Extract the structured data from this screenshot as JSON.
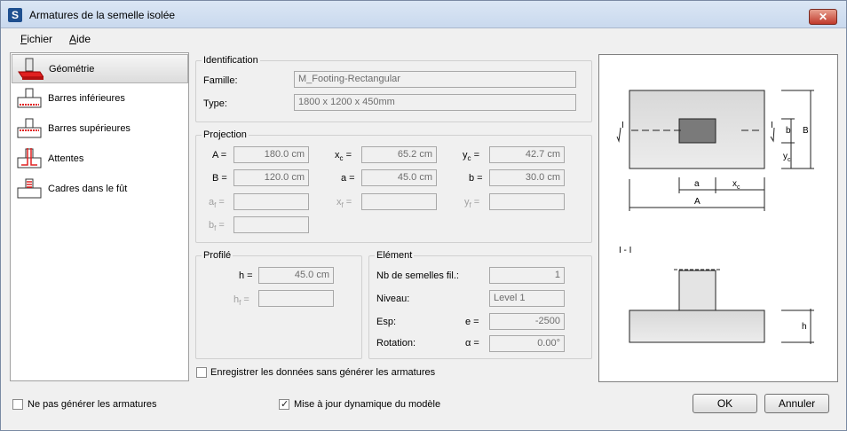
{
  "window": {
    "title": "Armatures de la semelle isolée",
    "app_icon": "S",
    "close_glyph": "✕"
  },
  "menu": {
    "items": [
      {
        "accel": "F",
        "rest": "ichier"
      },
      {
        "accel": "A",
        "rest": "ide"
      }
    ]
  },
  "nav": {
    "items": [
      {
        "label": "Géométrie",
        "icon": "footing-geometry-icon"
      },
      {
        "label": "Barres inférieures",
        "icon": "bottom-bars-icon"
      },
      {
        "label": "Barres supérieures",
        "icon": "top-bars-icon"
      },
      {
        "label": "Attentes",
        "icon": "starter-bars-icon"
      },
      {
        "label": "Cadres dans le fût",
        "icon": "pier-stirrups-icon"
      }
    ]
  },
  "identification": {
    "legend": "Identification",
    "famille_label": "Famille:",
    "famille_value": "M_Footing-Rectangular",
    "type_label": "Type:",
    "type_value": "1800 x 1200 x 450mm"
  },
  "projection": {
    "legend": "Projection",
    "A_label": "A =",
    "A_value": "180.0 cm",
    "B_label": "B =",
    "B_value": "120.0 cm",
    "af_base": "a",
    "af_sub": "f",
    "af_eq": "=",
    "af_value": "",
    "bf_base": "b",
    "bf_sub": "f",
    "bf_eq": "=",
    "bf_value": "",
    "xc_base": "x",
    "xc_sub": "c",
    "xc_eq": "=",
    "xc_value": "65.2 cm",
    "a_label": "a =",
    "a_value": "45.0 cm",
    "xf_base": "x",
    "xf_sub": "f",
    "xf_eq": "=",
    "xf_value": "",
    "yc_base": "y",
    "yc_sub": "c",
    "yc_eq": "=",
    "yc_value": "42.7 cm",
    "b_label": "b =",
    "b_value": "30.0 cm",
    "yf_base": "y",
    "yf_sub": "f",
    "yf_eq": "=",
    "yf_value": ""
  },
  "profile": {
    "legend": "Profilé",
    "h_label": "h =",
    "h_value": "45.0 cm",
    "hf_base": "h",
    "hf_sub": "f",
    "hf_eq": "=",
    "hf_value": ""
  },
  "element": {
    "legend": "Elément",
    "nb_label": "Nb de semelles fil.:",
    "nb_value": "1",
    "niveau_label": "Niveau:",
    "niveau_value": "Level 1",
    "esp_label": "Esp:",
    "e_label": "e =",
    "e_value": "-2500",
    "rotation_label": "Rotation:",
    "alpha_label": "α =",
    "alpha_value": "0.00°"
  },
  "options": {
    "save_data_label": "Enregistrer les données sans générer les armatures",
    "save_data_checked": false,
    "no_generate_label": "Ne pas générer les armatures",
    "no_generate_checked": false,
    "dynamic_update_label": "Mise à jour dynamique du modèle",
    "dynamic_update_checked": true
  },
  "buttons": {
    "ok": "OK",
    "cancel": "Annuler"
  },
  "drawing": {
    "plan": {
      "label_I_left": "I",
      "label_I_right": "I",
      "dim_a": "a",
      "dim_xc_base": "x",
      "dim_xc_sub": "c",
      "dim_A": "A",
      "dim_b": "b",
      "dim_B": "B",
      "dim_yc_base": "y",
      "dim_yc_sub": "c"
    },
    "section": {
      "title": "I - I",
      "dim_h": "h"
    }
  }
}
